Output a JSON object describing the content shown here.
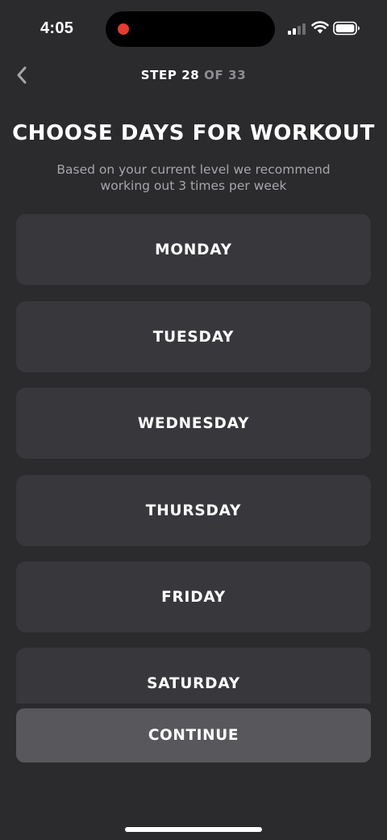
{
  "status_bar": {
    "time": "4:05",
    "recording_color": "#e53b30"
  },
  "header": {
    "back_icon": "chevron-left-icon",
    "step_label": "STEP 28",
    "step_total": "OF 33"
  },
  "main": {
    "title": "CHOOSE DAYS FOR WORKOUT",
    "subtitle": "Based on your current level we recommend working out 3 times per week",
    "days": [
      {
        "label": "MONDAY"
      },
      {
        "label": "TUESDAY"
      },
      {
        "label": "WEDNESDAY"
      },
      {
        "label": "THURSDAY"
      },
      {
        "label": "FRIDAY"
      },
      {
        "label": "SATURDAY"
      }
    ]
  },
  "footer": {
    "continue_label": "CONTINUE"
  },
  "colors": {
    "background": "#2b2a2d",
    "card": "#38373b",
    "continue_button": "#58575b",
    "muted_text": "#a7a6ab"
  }
}
